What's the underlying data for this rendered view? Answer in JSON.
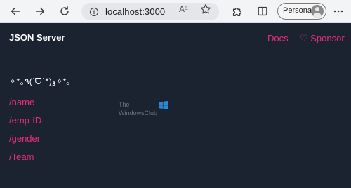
{
  "browser": {
    "address": {
      "url": "localhost:3000",
      "read_aloud_label": "Aᵃ"
    },
    "profile": {
      "label": "Personal"
    },
    "icons": {
      "back": "back-arrow-icon",
      "forward": "forward-arrow-icon",
      "refresh": "refresh-icon",
      "site_info": "info-icon",
      "favorite": "star-icon",
      "extensions": "puzzle-icon",
      "split_screen": "split-screen-icon",
      "avatar": "avatar-icon"
    }
  },
  "page": {
    "brand": "JSON Server",
    "nav": {
      "docs": "Docs",
      "sponsor": "♡ Sponsor"
    },
    "emoticon": "✧*｡٩(ˊᗜˋ*)و✧*｡",
    "resources": [
      "/name",
      "/emp-ID",
      "/gender",
      "/Team"
    ],
    "watermark": {
      "line1": "The",
      "line2": "WindowsClub",
      "logo": "windows-logo-icon"
    },
    "colors": {
      "background": "#1b2331",
      "accent": "#ea2d7a",
      "text": "#ffffff",
      "chrome": "#f3f4f6"
    }
  }
}
